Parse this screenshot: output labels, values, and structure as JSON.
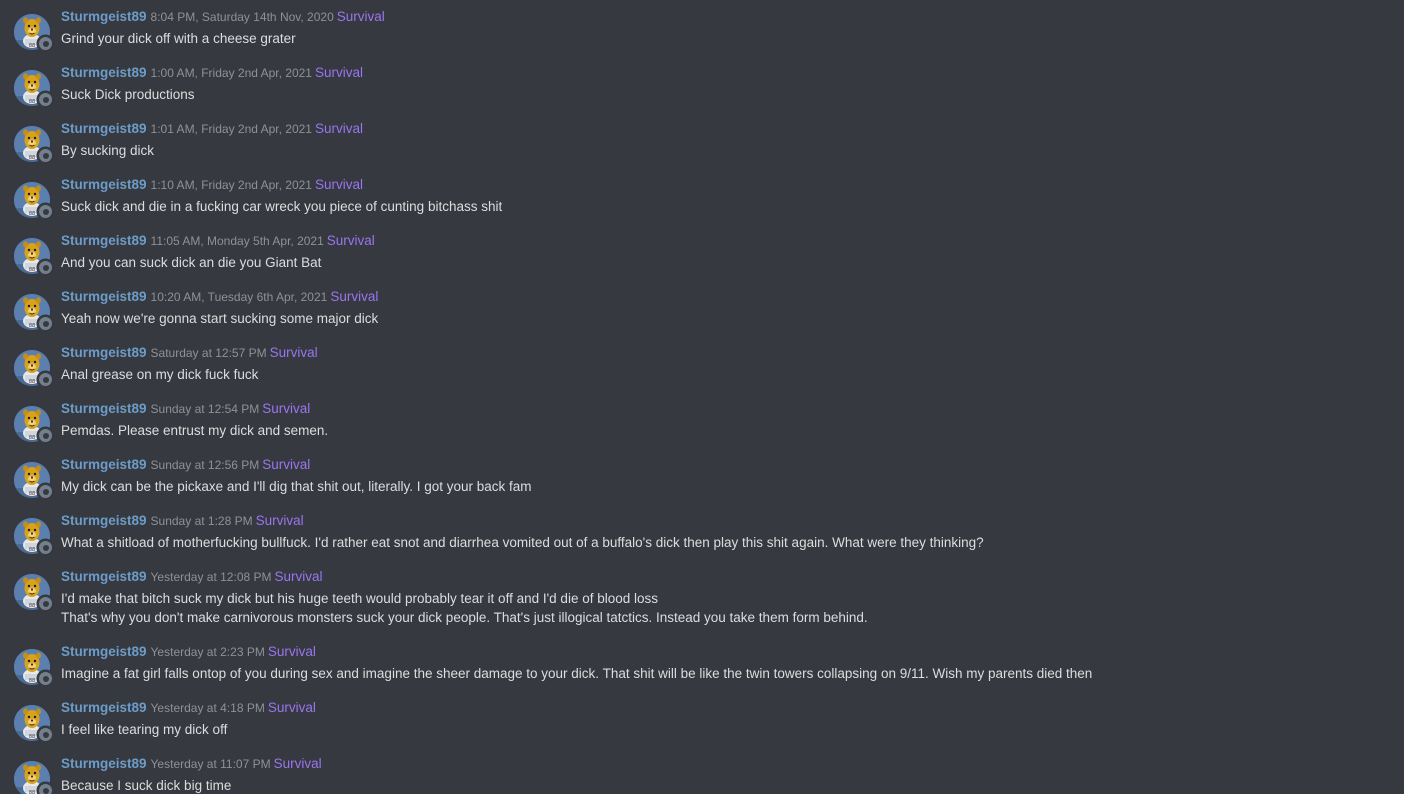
{
  "colors": {
    "background": "#36393f",
    "username": "#6d9cca",
    "timestamp": "#8e9297",
    "channel_tag": "#9a75f0",
    "message_text": "#dcddde",
    "avatar_bg": "#5b80b0",
    "status_offline": "#747f8d"
  },
  "avatar_icon": "cartoon-bear-avatar-icon",
  "messages": [
    {
      "username": "Sturmgeist89",
      "timestamp": "8:04 PM, Saturday 14th Nov, 2020",
      "channel": "Survival",
      "lines": [
        "Grind your dick off with a cheese grater"
      ]
    },
    {
      "username": "Sturmgeist89",
      "timestamp": "1:00 AM, Friday 2nd Apr, 2021",
      "channel": "Survival",
      "lines": [
        "Suck Dick productions"
      ]
    },
    {
      "username": "Sturmgeist89",
      "timestamp": "1:01 AM, Friday 2nd Apr, 2021",
      "channel": "Survival",
      "lines": [
        "By sucking dick"
      ]
    },
    {
      "username": "Sturmgeist89",
      "timestamp": "1:10 AM, Friday 2nd Apr, 2021",
      "channel": "Survival",
      "lines": [
        "Suck dick and die in a fucking car wreck you piece of cunting bitchass shit"
      ]
    },
    {
      "username": "Sturmgeist89",
      "timestamp": "11:05 AM, Monday 5th Apr, 2021",
      "channel": "Survival",
      "lines": [
        "And you can suck dick an die you Giant Bat"
      ]
    },
    {
      "username": "Sturmgeist89",
      "timestamp": "10:20 AM, Tuesday 6th Apr, 2021",
      "channel": "Survival",
      "lines": [
        "Yeah now we're gonna start sucking some major dick"
      ]
    },
    {
      "username": "Sturmgeist89",
      "timestamp": "Saturday at 12:57 PM",
      "channel": "Survival",
      "lines": [
        "Anal grease on my dick fuck fuck"
      ]
    },
    {
      "username": "Sturmgeist89",
      "timestamp": "Sunday at 12:54 PM",
      "channel": "Survival",
      "lines": [
        "Pemdas. Please entrust my dick and semen."
      ]
    },
    {
      "username": "Sturmgeist89",
      "timestamp": "Sunday at 12:56 PM",
      "channel": "Survival",
      "lines": [
        "My dick can be the pickaxe and I'll dig that shit out, literally. I got your back fam"
      ]
    },
    {
      "username": "Sturmgeist89",
      "timestamp": "Sunday at 1:28 PM",
      "channel": "Survival",
      "lines": [
        "What a shitload of motherfucking bullfuck. I'd rather eat snot and diarrhea vomited out of a buffalo's dick then play this shit again. What were they thinking?"
      ]
    },
    {
      "username": "Sturmgeist89",
      "timestamp": "Yesterday at 12:08 PM",
      "channel": "Survival",
      "lines": [
        "I'd make that bitch suck my dick but his huge teeth would probably tear it off and I'd die of blood loss",
        "That's why you don't make carnivorous monsters suck your dick people. That's just illogical tatctics. Instead you take them form behind."
      ]
    },
    {
      "username": "Sturmgeist89",
      "timestamp": "Yesterday at 2:23 PM",
      "channel": "Survival",
      "lines": [
        "Imagine a fat girl falls ontop of you during sex and imagine the sheer damage to your dick. That shit will be like the twin towers collapsing on 9/11. Wish my parents died then"
      ]
    },
    {
      "username": "Sturmgeist89",
      "timestamp": "Yesterday at 4:18 PM",
      "channel": "Survival",
      "lines": [
        "I feel like tearing my dick off"
      ]
    },
    {
      "username": "Sturmgeist89",
      "timestamp": "Yesterday at 11:07 PM",
      "channel": "Survival",
      "lines": [
        "Because I suck dick big time"
      ]
    }
  ]
}
